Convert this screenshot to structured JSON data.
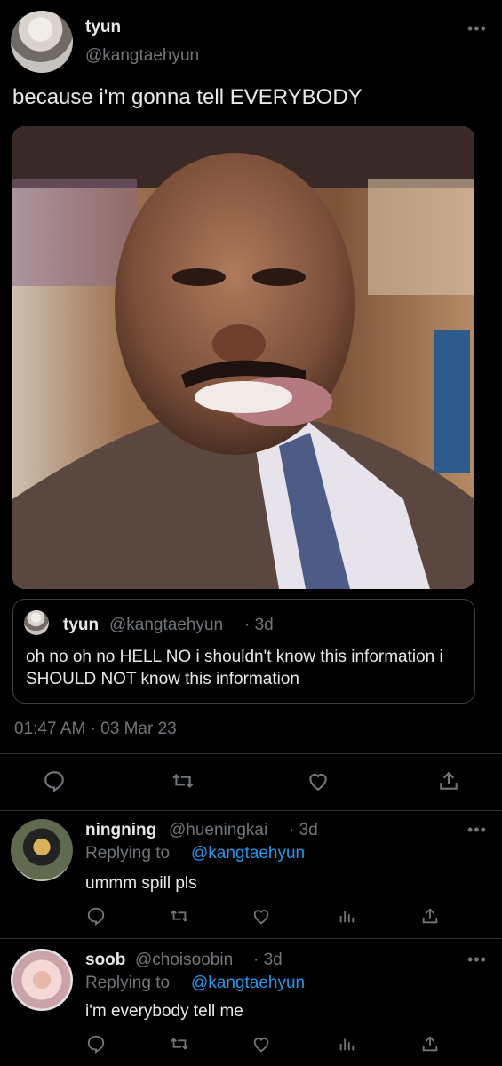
{
  "tweet": {
    "author_name": "tyun",
    "author_handle": "@kangtaehyun",
    "text": "because i'm gonna tell EVERYBODY",
    "timestamp": "01:47 AM · 03 Mar 23",
    "more_icon": "more-dots-icon",
    "photo_icon": "photo"
  },
  "quote": {
    "author_name": "tyun",
    "author_handle": "@kangtaehyun",
    "age": "· 3d",
    "text": "oh no oh no HELL NO i shouldn't know this information i SHOULD NOT know this information"
  },
  "actions": [
    "reply-icon",
    "retweet-icon",
    "like-icon",
    "share-icon"
  ],
  "replies": [
    {
      "author_name": "ningning",
      "author_handle": "@hueningkai",
      "age": "· 3d",
      "replying_prefix": "Replying to",
      "replying_handle": "@kangtaehyun",
      "text": "ummm spill pls"
    },
    {
      "author_name": "soob",
      "author_handle": "@choisoobin",
      "age": "· 3d",
      "replying_prefix": "Replying to",
      "replying_handle": "@kangtaehyun",
      "text": "i'm everybody tell me"
    }
  ],
  "colors": {
    "background": "#000000",
    "text": "#e7e9ea",
    "muted": "#71767b",
    "link": "#1d9bf0",
    "border": "#2f3336"
  }
}
